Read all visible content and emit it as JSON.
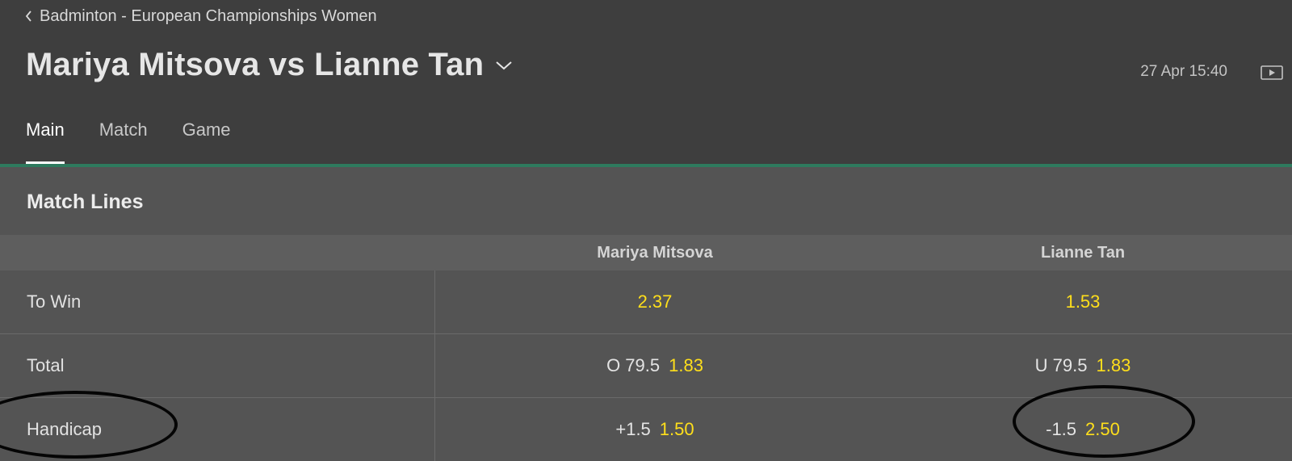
{
  "breadcrumb": {
    "label": "Badminton - European Championships Women"
  },
  "event": {
    "title": "Mariya Mitsova vs Lianne Tan",
    "datetime": "27 Apr 15:40"
  },
  "tabs": [
    {
      "label": "Main",
      "active": true
    },
    {
      "label": "Match",
      "active": false
    },
    {
      "label": "Game",
      "active": false
    }
  ],
  "section": {
    "title": "Match Lines"
  },
  "columns": [
    "Mariya Mitsova",
    "Lianne Tan"
  ],
  "rows": [
    {
      "label": "To Win",
      "cells": [
        {
          "line": "",
          "odds": "2.37"
        },
        {
          "line": "",
          "odds": "1.53"
        }
      ]
    },
    {
      "label": "Total",
      "cells": [
        {
          "line": "O 79.5",
          "odds": "1.83"
        },
        {
          "line": "U 79.5",
          "odds": "1.83"
        }
      ]
    },
    {
      "label": "Handicap",
      "cells": [
        {
          "line": "+1.5",
          "odds": "1.50"
        },
        {
          "line": "-1.5",
          "odds": "2.50"
        }
      ]
    }
  ],
  "colors": {
    "header_bg": "#3e3e3e",
    "body_bg": "#545454",
    "accent": "#2e7a5e",
    "odds": "#ffdf1b"
  },
  "icons": {
    "back": "chevron-left-icon",
    "title_dropdown": "chevron-down-icon",
    "stream": "video-icon"
  }
}
